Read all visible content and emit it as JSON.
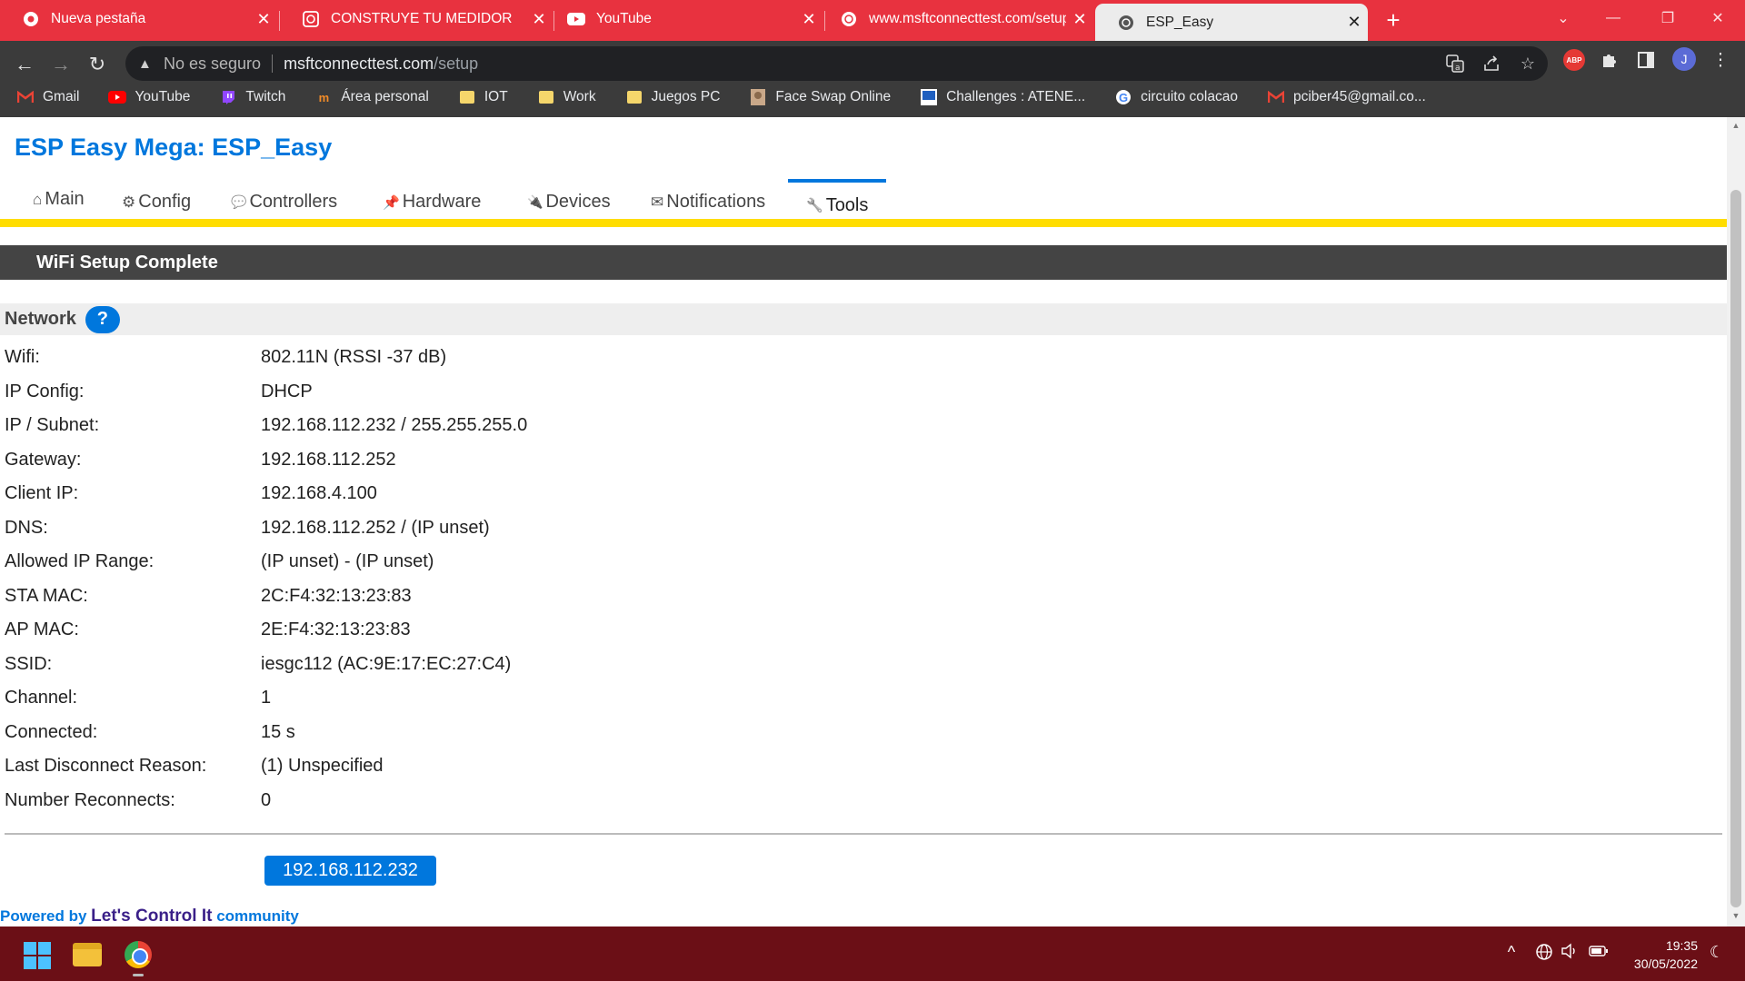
{
  "browser": {
    "tabs": [
      {
        "title": "Nueva pestaña",
        "icon": "chrome-icon"
      },
      {
        "title": "CONSTRUYE TU MEDIDOR",
        "icon": "site-icon"
      },
      {
        "title": "YouTube",
        "icon": "youtube-icon"
      },
      {
        "title": "www.msftconnecttest.com/setup",
        "icon": "globe-icon"
      },
      {
        "title": "ESP_Easy",
        "icon": "globe-icon"
      }
    ],
    "address": {
      "security_label": "No es seguro",
      "host": "msftconnecttest.com",
      "path": "/setup"
    },
    "profile_initial": "J",
    "extension_badge": "ABP",
    "bookmarks": [
      {
        "label": "Gmail",
        "icon": "gmail-icon"
      },
      {
        "label": "YouTube",
        "icon": "youtube-icon"
      },
      {
        "label": "Twitch",
        "icon": "twitch-icon"
      },
      {
        "label": "Área personal",
        "icon": "site-icon"
      },
      {
        "label": "IOT",
        "icon": "folder-icon"
      },
      {
        "label": "Work",
        "icon": "folder-icon"
      },
      {
        "label": "Juegos PC",
        "icon": "folder-icon"
      },
      {
        "label": "Face Swap Online",
        "icon": "site-icon"
      },
      {
        "label": "Challenges : ATENE...",
        "icon": "site-icon"
      },
      {
        "label": "circuito colacao",
        "icon": "google-icon"
      },
      {
        "label": "pciber45@gmail.co...",
        "icon": "gmail-icon"
      }
    ]
  },
  "page": {
    "title": "ESP Easy Mega: ESP_Easy",
    "menu": [
      {
        "label": "Main",
        "icon": "⌂"
      },
      {
        "label": "Config",
        "icon": "⚙"
      },
      {
        "label": "Controllers",
        "icon": "💬"
      },
      {
        "label": "Hardware",
        "icon": "📌"
      },
      {
        "label": "Devices",
        "icon": "🔌"
      },
      {
        "label": "Notifications",
        "icon": "✉"
      },
      {
        "label": "Tools",
        "icon": "🔧"
      }
    ],
    "active_menu": "Tools",
    "section_title": "WiFi Setup Complete",
    "network_label": "Network",
    "help_label": "?",
    "rows": [
      {
        "key": "Wifi:",
        "value": "802.11N (RSSI -37 dB)"
      },
      {
        "key": "IP Config:",
        "value": "DHCP"
      },
      {
        "key": "IP / Subnet:",
        "value": "192.168.112.232 / 255.255.255.0"
      },
      {
        "key": "Gateway:",
        "value": "192.168.112.252"
      },
      {
        "key": "Client IP:",
        "value": "192.168.4.100"
      },
      {
        "key": "DNS:",
        "value": "192.168.112.252 / (IP unset)"
      },
      {
        "key": "Allowed IP Range:",
        "value": "(IP unset) - (IP unset)"
      },
      {
        "key": "STA MAC:",
        "value": "2C:F4:32:13:23:83"
      },
      {
        "key": "AP MAC:",
        "value": "2E:F4:32:13:23:83"
      },
      {
        "key": "SSID:",
        "value": "iesgc112 (AC:9E:17:EC:27:C4)"
      },
      {
        "key": "Channel:",
        "value": "1"
      },
      {
        "key": "Connected:",
        "value": "15 s"
      },
      {
        "key": "Last Disconnect Reason:",
        "value": "(1) Unspecified"
      },
      {
        "key": "Number Reconnects:",
        "value": "0"
      }
    ],
    "ip_button": "192.168.112.232",
    "footer": {
      "prefix": "Powered by",
      "brand": "Let's Control It",
      "suffix": "community"
    }
  },
  "taskbar": {
    "time": "19:35",
    "date": "30/05/2022"
  },
  "colors": {
    "accent": "#0077dd",
    "menu_bar": "#ffdd00",
    "header_band": "#444444",
    "browser_frame": "#e8323f",
    "taskbar": "#6b0f16"
  }
}
